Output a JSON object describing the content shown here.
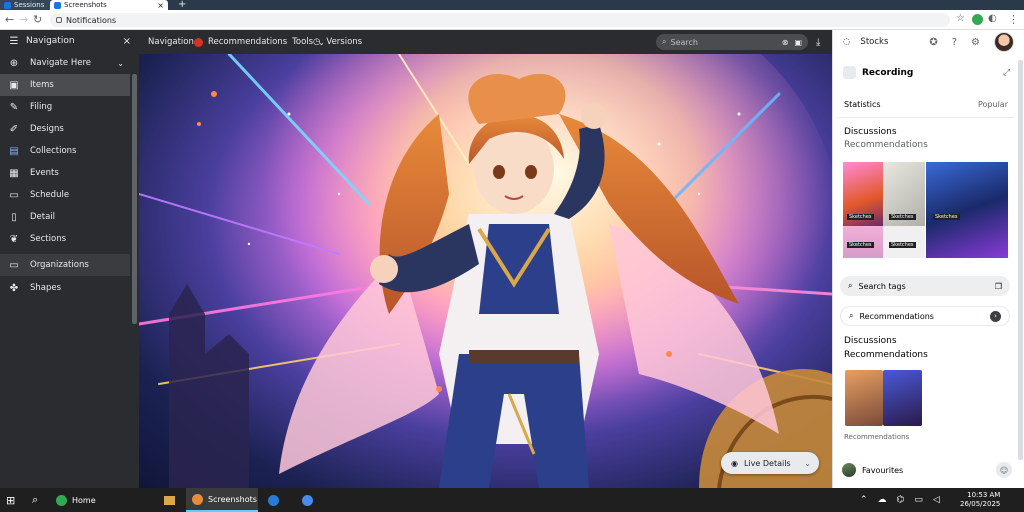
{
  "browser": {
    "tabs": [
      {
        "label": "Sessions"
      },
      {
        "label": "Screenshots"
      }
    ],
    "new_tab": "+",
    "url": "Notifications"
  },
  "sidebar": {
    "header": "Navigation",
    "close": "×",
    "items": [
      {
        "label": "Navigate Here",
        "icon": "compass-icon"
      },
      {
        "label": "Items",
        "icon": "image-icon"
      },
      {
        "label": "Filing",
        "icon": "pencil-icon"
      },
      {
        "label": "Designs",
        "icon": "brush-icon"
      },
      {
        "label": "Collections",
        "icon": "grid-icon"
      },
      {
        "label": "Events",
        "icon": "calendar-icon"
      },
      {
        "label": "Schedule",
        "icon": "document-icon"
      },
      {
        "label": "Detail",
        "icon": "file-icon"
      },
      {
        "label": "Sections",
        "icon": "bookmark-icon"
      },
      {
        "label": "Organizations",
        "icon": "folder-icon"
      },
      {
        "label": "Shapes",
        "icon": "puzzle-icon"
      }
    ]
  },
  "viewer_toolbar": {
    "title": "Navigation",
    "tags": "Recommendations",
    "tags_extra": "Tools",
    "other": "Versions",
    "search_placeholder": "Search"
  },
  "viewer": {
    "float_button": "Live Details"
  },
  "right_panel": {
    "top_label": "Stocks",
    "section_title": "Recording",
    "sort_label": "Statistics",
    "sort_value": "Popular",
    "card1_title": "Discussions",
    "card1_subtitle": "Recommendations",
    "thumb_labels": [
      "Sketches",
      "Sketches",
      "Sketches"
    ],
    "thumb_labels2": [
      "Sketches",
      "Sketches"
    ],
    "chip1": "Search tags",
    "chip2": "Recommendations",
    "card2_title": "Discussions",
    "card2_subtitle": "Recommendations",
    "card2_caption": "Recommendations",
    "footer_label": "Favourites"
  },
  "taskbar": {
    "search_label": "Home",
    "app_label": "Screenshots",
    "time": "10:53 AM",
    "date": "26/05/2025"
  }
}
